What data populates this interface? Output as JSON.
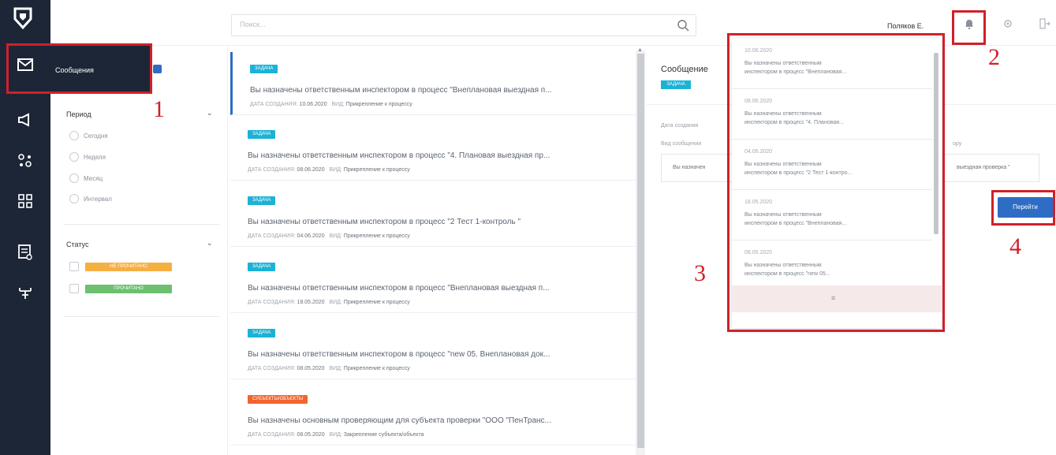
{
  "topbar": {
    "search_placeholder": "Поиск...",
    "user_name": "Поляков Е."
  },
  "sidebar": {
    "icons": [
      "megaphone-icon",
      "network-icon",
      "grid-icon",
      "checklist-icon",
      "hierarchy-icon"
    ]
  },
  "filter": {
    "messages_label": "Сообщения",
    "period_title": "Период",
    "period_options": [
      "Сегодня",
      "Неделя",
      "Месяц",
      "Интервал"
    ],
    "status_title": "Статус",
    "status_tags": [
      {
        "label": "НЕ ПРОЧИТАНО",
        "color": "#f5b042"
      },
      {
        "label": "ПРОЧИТАНО",
        "color": "#6cc070"
      }
    ]
  },
  "messages": [
    {
      "badge": "ЗАДАЧА",
      "badge_color": "#1cb2d6",
      "title": "Вы назначены ответственным инспектором в процесс \"Внеплановая выездная п...",
      "date_label": "ДАТА СОЗДАНИЯ:",
      "date": "10.06.2020",
      "type_label": "ВИД:",
      "type": "Прикрепление к процессу"
    },
    {
      "badge": "ЗАДАЧА",
      "badge_color": "#1cb2d6",
      "title": "Вы назначены ответственным инспектором в процесс \"4. Плановая выездная пр...",
      "date_label": "ДАТА СОЗДАНИЯ:",
      "date": "08.06.2020",
      "type_label": "ВИД:",
      "type": "Прикрепление к процессу"
    },
    {
      "badge": "ЗАДАЧА",
      "badge_color": "#1cb2d6",
      "title": "Вы назначены ответственным инспектором в процесс \"2 Тест 1-контроль \"",
      "date_label": "ДАТА СОЗДАНИЯ:",
      "date": "04.06.2020",
      "type_label": "ВИД:",
      "type": "Прикрепление к процессу"
    },
    {
      "badge": "ЗАДАЧА",
      "badge_color": "#1cb2d6",
      "title": "Вы назначены ответственным инспектором в процесс \"Внеплановая выездная п...",
      "date_label": "ДАТА СОЗДАНИЯ:",
      "date": "18.05.2020",
      "type_label": "ВИД:",
      "type": "Прикрепление к процессу"
    },
    {
      "badge": "ЗАДАЧА",
      "badge_color": "#1cb2d6",
      "title": "Вы назначены ответственным инспектором в процесс \"new 05. Внеплановая док...",
      "date_label": "ДАТА СОЗДАНИЯ:",
      "date": "08.05.2020",
      "type_label": "ВИД:",
      "type": "Прикрепление к процессу"
    },
    {
      "badge": "СУБЪЕКТЫ/ОБЪЕКТЫ",
      "badge_color": "#f0652f",
      "title": "Вы назначены основным проверяющим для субъекта проверки \"ООО \"ПенТранс...",
      "date_label": "ДАТА СОЗДАНИЯ:",
      "date": "08.05.2020",
      "type_label": "ВИД:",
      "type": "Закрепление субъекта/объекта"
    }
  ],
  "detail": {
    "heading": "Сообщение",
    "badge": "ЗАДАЧА",
    "date_created_label": "Дата создания",
    "message_type_label": "Вид сообщения",
    "body_start": "Вы назначен",
    "body_end": "выездная проверка \"",
    "right_label": "ору",
    "goto_label": "Перейти"
  },
  "notifications": [
    {
      "date": "10.06.2020",
      "text1": "Вы назначены ответственным",
      "text2": "инспектором в процесс \"Внеплановая..."
    },
    {
      "date": "08.06.2020",
      "text1": "Вы назначены ответственным",
      "text2": "инспектором в процесс \"4. Плановая..."
    },
    {
      "date": "04.06.2020",
      "text1": "Вы назначены ответственным",
      "text2": "инспектором в процесс \"2 Тест 1-контро..."
    },
    {
      "date": "18.05.2020",
      "text1": "Вы назначены ответственным",
      "text2": "инспектором в процесс \"Внеплановая..."
    },
    {
      "date": "08.05.2020",
      "text1": "Вы назначены ответственным",
      "text2": "инспектором в процесс \"new 05..."
    }
  ],
  "notifications_footer": "≡",
  "annotations": [
    "1",
    "2",
    "3",
    "4"
  ]
}
